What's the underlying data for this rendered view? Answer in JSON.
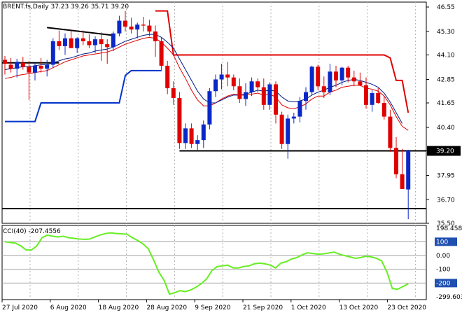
{
  "chart_data": [
    {
      "type": "candlestick",
      "header": "BRENT.fs,Daily  37.23 39.26 35.71 39.20",
      "symbol": "BRENT.fs",
      "timeframe": "Daily",
      "ohlc_last": {
        "open": 37.23,
        "high": 39.26,
        "low": 35.71,
        "close": 39.2
      },
      "current_price_label": "39.20",
      "price_ticks": [
        "46.55",
        "45.30",
        "44.10",
        "42.85",
        "41.65",
        "40.40",
        "39.20",
        "37.95",
        "36.70",
        "35.50"
      ],
      "ylim": [
        35.5,
        46.8
      ],
      "x_ticks": [
        "27 Jul 2020",
        "6 Aug 2020",
        "18 Aug 2020",
        "28 Aug 2020",
        "9 Sep 2020",
        "21 Sep 2020",
        "1 Oct 2020",
        "13 Oct 2020",
        "23 Oct 2020"
      ],
      "x_tick_index": [
        0,
        8,
        16,
        24,
        32,
        40,
        48,
        56,
        64
      ],
      "candles": [
        [
          43.85,
          44.05,
          43.1,
          43.65
        ],
        [
          43.6,
          43.95,
          43.2,
          43.4
        ],
        [
          43.4,
          43.9,
          42.95,
          43.75
        ],
        [
          43.7,
          44.0,
          43.35,
          43.5
        ],
        [
          43.5,
          43.8,
          41.8,
          43.2
        ],
        [
          43.2,
          43.7,
          42.8,
          43.55
        ],
        [
          43.55,
          43.95,
          43.2,
          43.4
        ],
        [
          43.4,
          43.85,
          43.0,
          43.6
        ],
        [
          43.6,
          44.95,
          43.45,
          44.8
        ],
        [
          44.8,
          45.35,
          44.35,
          44.55
        ],
        [
          44.55,
          45.2,
          44.1,
          44.95
        ],
        [
          44.95,
          45.35,
          44.5,
          44.45
        ],
        [
          44.45,
          45.0,
          44.2,
          44.95
        ],
        [
          44.95,
          45.35,
          44.6,
          44.8
        ],
        [
          44.8,
          45.15,
          44.45,
          44.6
        ],
        [
          44.6,
          45.05,
          44.2,
          44.9
        ],
        [
          44.9,
          45.25,
          43.8,
          44.65
        ],
        [
          44.65,
          44.9,
          43.65,
          44.5
        ],
        [
          44.5,
          45.3,
          44.3,
          45.2
        ],
        [
          45.2,
          46.1,
          45.05,
          45.85
        ],
        [
          45.85,
          46.35,
          45.3,
          45.55
        ],
        [
          45.55,
          46.0,
          45.2,
          45.4
        ],
        [
          45.4,
          45.75,
          44.95,
          45.65
        ],
        [
          45.65,
          46.05,
          45.3,
          45.6
        ],
        [
          45.6,
          45.9,
          45.05,
          45.3
        ],
        [
          45.3,
          45.6,
          44.0,
          44.8
        ],
        [
          44.8,
          45.0,
          43.3,
          43.55
        ],
        [
          43.55,
          43.8,
          42.1,
          42.4
        ],
        [
          42.4,
          42.75,
          41.55,
          41.9
        ],
        [
          41.9,
          42.2,
          39.3,
          39.6
        ],
        [
          39.6,
          40.6,
          39.3,
          40.35
        ],
        [
          40.35,
          40.6,
          39.35,
          39.55
        ],
        [
          39.55,
          40.0,
          39.25,
          39.75
        ],
        [
          39.75,
          40.75,
          39.35,
          40.55
        ],
        [
          40.55,
          42.4,
          40.3,
          42.25
        ],
        [
          42.25,
          43.1,
          41.95,
          42.85
        ],
        [
          42.85,
          43.65,
          42.35,
          43.1
        ],
        [
          43.1,
          43.75,
          42.5,
          42.95
        ],
        [
          42.95,
          43.1,
          42.3,
          42.5
        ],
        [
          42.5,
          42.9,
          41.65,
          41.85
        ],
        [
          41.85,
          42.65,
          41.5,
          42.2
        ],
        [
          42.2,
          42.95,
          42.0,
          42.75
        ],
        [
          42.75,
          42.9,
          42.2,
          42.45
        ],
        [
          42.45,
          42.9,
          41.3,
          41.55
        ],
        [
          41.55,
          42.7,
          41.3,
          42.6
        ],
        [
          42.6,
          42.75,
          40.6,
          41.05
        ],
        [
          41.05,
          41.2,
          39.3,
          39.55
        ],
        [
          39.55,
          41.05,
          38.8,
          40.85
        ],
        [
          40.85,
          41.15,
          40.6,
          40.95
        ],
        [
          40.95,
          41.95,
          40.65,
          41.75
        ],
        [
          41.75,
          42.45,
          41.3,
          42.2
        ],
        [
          42.2,
          43.55,
          42.05,
          43.5
        ],
        [
          43.5,
          43.6,
          42.3,
          42.5
        ],
        [
          42.5,
          43.0,
          41.9,
          42.2
        ],
        [
          42.2,
          43.65,
          42.05,
          43.25
        ],
        [
          43.25,
          43.55,
          42.45,
          42.8
        ],
        [
          42.8,
          43.5,
          42.55,
          43.45
        ],
        [
          43.45,
          43.55,
          42.7,
          42.95
        ],
        [
          42.95,
          43.3,
          42.5,
          42.75
        ],
        [
          42.75,
          43.2,
          42.5,
          42.55
        ],
        [
          42.55,
          42.95,
          41.35,
          41.55
        ],
        [
          41.55,
          42.3,
          41.2,
          42.15
        ],
        [
          42.15,
          42.4,
          41.6,
          41.65
        ],
        [
          41.65,
          42.0,
          40.8,
          40.95
        ],
        [
          40.95,
          41.3,
          39.15,
          39.35
        ],
        [
          39.35,
          39.9,
          37.8,
          38.0
        ],
        [
          38.0,
          39.3,
          37.65,
          37.25
        ],
        [
          37.23,
          39.26,
          35.71,
          39.2
        ]
      ],
      "ema_red": [
        42.9,
        42.95,
        43.05,
        43.1,
        43.15,
        43.2,
        43.25,
        43.3,
        43.45,
        43.6,
        43.75,
        43.85,
        43.95,
        44.05,
        44.1,
        44.15,
        44.2,
        44.25,
        44.35,
        44.5,
        44.65,
        44.75,
        44.85,
        44.95,
        45.0,
        44.95,
        44.75,
        44.45,
        44.1,
        43.45,
        42.9,
        42.3,
        41.8,
        41.5,
        41.5,
        41.65,
        41.85,
        42.0,
        42.1,
        42.05,
        42.05,
        42.1,
        42.15,
        42.05,
        42.1,
        41.95,
        41.55,
        41.4,
        41.35,
        41.45,
        41.6,
        41.85,
        42.0,
        42.0,
        42.2,
        42.3,
        42.45,
        42.5,
        42.55,
        42.55,
        42.4,
        42.35,
        42.25,
        42.0,
        41.55,
        40.95,
        40.45,
        40.25
      ],
      "ema_blue": [
        43.35,
        43.4,
        43.45,
        43.5,
        43.5,
        43.55,
        43.6,
        43.6,
        43.7,
        43.8,
        43.9,
        43.95,
        44.05,
        44.15,
        44.2,
        44.3,
        44.35,
        44.4,
        44.5,
        44.65,
        44.8,
        44.9,
        45.0,
        45.1,
        45.15,
        45.15,
        45.0,
        44.75,
        44.45,
        43.9,
        43.35,
        42.8,
        42.25,
        41.85,
        41.65,
        41.65,
        41.8,
        41.95,
        42.05,
        42.05,
        42.1,
        42.2,
        42.3,
        42.25,
        42.3,
        42.25,
        41.95,
        41.75,
        41.7,
        41.75,
        41.85,
        42.05,
        42.2,
        42.3,
        42.45,
        42.55,
        42.7,
        42.8,
        42.85,
        42.8,
        42.7,
        42.6,
        42.45,
        42.15,
        41.7,
        41.15,
        40.6
      ],
      "upper_channel": [
        null,
        null,
        null,
        null,
        null,
        null,
        null,
        null,
        null,
        null,
        null,
        null,
        null,
        null,
        null,
        null,
        null,
        null,
        null,
        null,
        null,
        null,
        null,
        null,
        null,
        46.35,
        46.35,
        46.35,
        44.1,
        44.1,
        44.1,
        44.1,
        44.1,
        44.1,
        44.1,
        44.1,
        44.1,
        44.1,
        44.1,
        44.1,
        44.1,
        44.1,
        44.1,
        44.1,
        44.1,
        44.1,
        44.1,
        44.1,
        44.1,
        44.1,
        44.1,
        44.1,
        44.1,
        44.1,
        44.1,
        44.1,
        44.1,
        44.1,
        44.1,
        44.1,
        44.1,
        44.1,
        44.1,
        44.1,
        43.95,
        42.8,
        42.8,
        41.15
      ],
      "lower_channel": [
        40.7,
        40.7,
        40.7,
        40.7,
        40.7,
        40.7,
        41.65,
        41.65,
        41.65,
        41.65,
        41.65,
        41.65,
        41.65,
        41.65,
        41.65,
        41.65,
        41.65,
        41.65,
        41.65,
        41.65,
        43.05,
        43.3,
        43.3,
        43.3,
        43.3,
        43.3,
        43.3
      ],
      "support_level": 39.2,
      "lower_level": 36.25,
      "resistance_line": {
        "from": [
          7,
          45.5
        ],
        "to": [
          18,
          45.1
        ]
      },
      "left_level": {
        "from": [
          0,
          43.7
        ],
        "to": [
          9,
          43.7
        ]
      },
      "cci": {
        "label": "CCI(40) -207.4556",
        "scale_max_label": "198.4581",
        "scale_min_label": "-299.603",
        "ylim": [
          -299.603,
          198.4581
        ],
        "levels": [
          "100",
          "0.00",
          "-100",
          "-200"
        ],
        "level_values": [
          100,
          0,
          -100,
          -200
        ],
        "highlight_levels": [
          100,
          -200
        ],
        "values": [
          100,
          95,
          90,
          70,
          40,
          40,
          70,
          130,
          148,
          140,
          135,
          140,
          130,
          125,
          120,
          118,
          120,
          135,
          150,
          160,
          165,
          160,
          158,
          155,
          130,
          110,
          85,
          50,
          -30,
          -120,
          -180,
          -280,
          -270,
          -255,
          -262,
          -250,
          -230,
          -205,
          -170,
          -110,
          -80,
          -75,
          -70,
          -90,
          -90,
          -80,
          -75,
          -60,
          -55,
          -60,
          -70,
          -90,
          -55,
          -45,
          -25,
          -15,
          5,
          20,
          15,
          10,
          12,
          18,
          25,
          10,
          0,
          -10,
          -20,
          -15,
          -5,
          -10,
          -20,
          -40,
          -120,
          -240,
          -245,
          -225,
          -205
        ]
      }
    }
  ]
}
